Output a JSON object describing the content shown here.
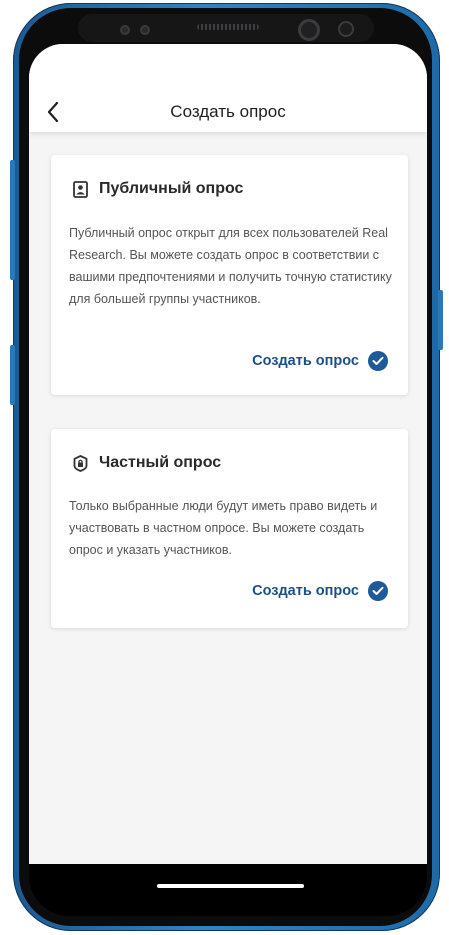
{
  "header": {
    "title": "Создать опрос"
  },
  "cards": [
    {
      "icon": "user-badge-icon",
      "title": "Публичный опрос",
      "description": "Публичный опрос открыт для всех пользователей Real Research. Вы можете создать опрос в соответствии с вашими предпочтениями и получить точную статистику для большей группы участников.",
      "action_label": "Создать опрос"
    },
    {
      "icon": "lock-shield-icon",
      "title": "Частный опрос",
      "description": "Только выбранные люди будут иметь право видеть и участвовать в частном опросе. Вы можете создать опрос и указать участников.",
      "action_label": "Создать опрос"
    }
  ],
  "colors": {
    "accent": "#1d5a97",
    "background": "#f5f5f5",
    "card": "#ffffff",
    "frame": "#2f84c7"
  }
}
